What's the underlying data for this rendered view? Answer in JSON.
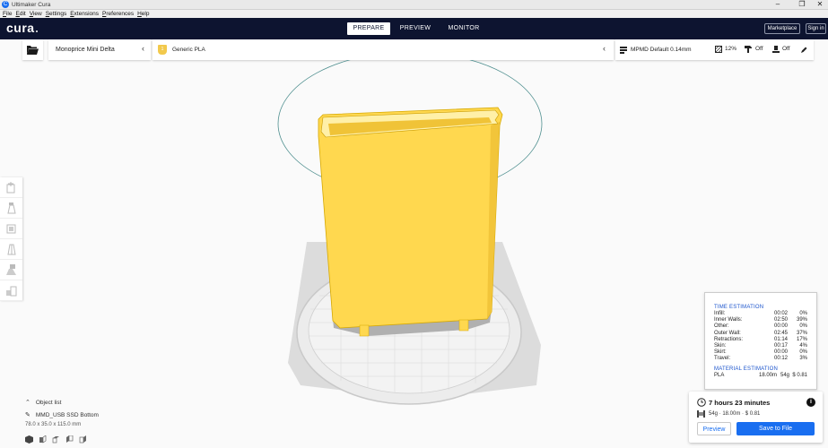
{
  "window": {
    "title": "Ultimaker Cura",
    "app_icon": "C",
    "minimize": "–",
    "maximize": "❐",
    "close": "✕"
  },
  "menu": [
    "File",
    "Edit",
    "View",
    "Settings",
    "Extensions",
    "Preferences",
    "Help"
  ],
  "header": {
    "logo": "cura",
    "tabs": [
      {
        "label": "PREPARE",
        "active": true
      },
      {
        "label": "PREVIEW",
        "active": false
      },
      {
        "label": "MONITOR",
        "active": false
      }
    ],
    "marketplace": "Marketplace",
    "signin": "Sign in"
  },
  "stagebar": {
    "printer": "Monoprice Mini Delta",
    "material": "Generic PLA",
    "profile": "MPMD Default 0.14mm",
    "infill": "12%",
    "support": "Off",
    "adhesion": "Off"
  },
  "object_list": {
    "title": "Object list",
    "object_name": "MMD_USB SSD Bottom",
    "dimensions": "78.0 x 35.0 x 115.0 mm"
  },
  "time_estimation": {
    "title": "TIME ESTIMATION",
    "rows": [
      {
        "label": "Infill:",
        "time": "00:02",
        "pct": "0%"
      },
      {
        "label": "Inner Walls:",
        "time": "02:50",
        "pct": "39%"
      },
      {
        "label": "Other:",
        "time": "00:00",
        "pct": "0%"
      },
      {
        "label": "Outer Wall:",
        "time": "02:45",
        "pct": "37%"
      },
      {
        "label": "Retractions:",
        "time": "01:14",
        "pct": "17%"
      },
      {
        "label": "Skin:",
        "time": "00:17",
        "pct": "4%"
      },
      {
        "label": "Skirt:",
        "time": "00:00",
        "pct": "0%"
      },
      {
        "label": "Travel:",
        "time": "00:12",
        "pct": "3%"
      }
    ],
    "material_title": "MATERIAL ESTIMATION",
    "material": {
      "name": "PLA",
      "length": "18.00m",
      "weight": "54g",
      "cost": "$ 0.81"
    }
  },
  "action_panel": {
    "print_time": "7 hours 23 minutes",
    "material_summary": "54g · 18.00m · $ 0.81",
    "info_icon": "i",
    "preview_button": "Preview",
    "save_button": "Save to File"
  },
  "colors": {
    "header_bg": "#0d1430",
    "accent": "#196ef0",
    "model_yellow": "#ffd84f",
    "estimation_heading": "#1a53cc"
  }
}
